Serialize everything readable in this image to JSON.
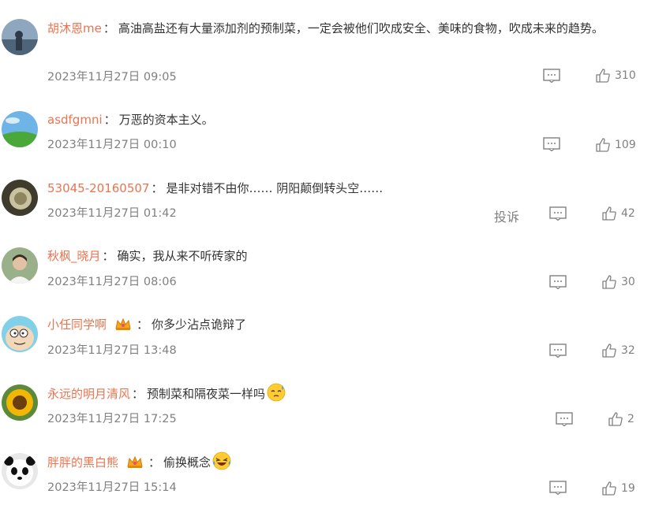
{
  "comments": [
    {
      "username": "胡沐恩me",
      "content": "高油高盐还有大量添加剂的预制菜，一定会被他们吹成安全、美味的食物，吹成未来的趋势。",
      "time": "2023年11月27日 09:05",
      "likes": "310"
    },
    {
      "username": "asdfgmni",
      "content": "万恶的资本主义。",
      "time": "2023年11月27日 00:10",
      "likes": "109"
    },
    {
      "username": "53045-20160507",
      "content": "是非对错不由你…… 阴阳颠倒转头空……",
      "time": "2023年11月27日 01:42",
      "likes": "42",
      "report_label": "投诉"
    },
    {
      "username": "秋枫_晓月",
      "content": "确实，我从来不听砖家的",
      "time": "2023年11月27日 08:06",
      "likes": "30"
    },
    {
      "username": "小任同学啊",
      "content": "你多少沾点诡辩了",
      "time": "2023年11月27日 13:48",
      "likes": "32",
      "badge_icon": "crown-badge-icon"
    },
    {
      "username": "永远的明月清风",
      "content": "预制菜和隔夜菜一样吗",
      "time": "2023年11月27日 17:25",
      "likes": "2",
      "emoji_icon": "sweat-emoji-icon"
    },
    {
      "username": "胖胖的黑白熊",
      "content": "偷换概念",
      "time": "2023年11月27日 15:14",
      "likes": "19",
      "badge_icon": "crown-badge-icon",
      "emoji_icon": "laughing-tears-emoji-icon"
    }
  ],
  "colors": {
    "username": "#eb7350",
    "meta": "#808080",
    "text": "#333333"
  }
}
